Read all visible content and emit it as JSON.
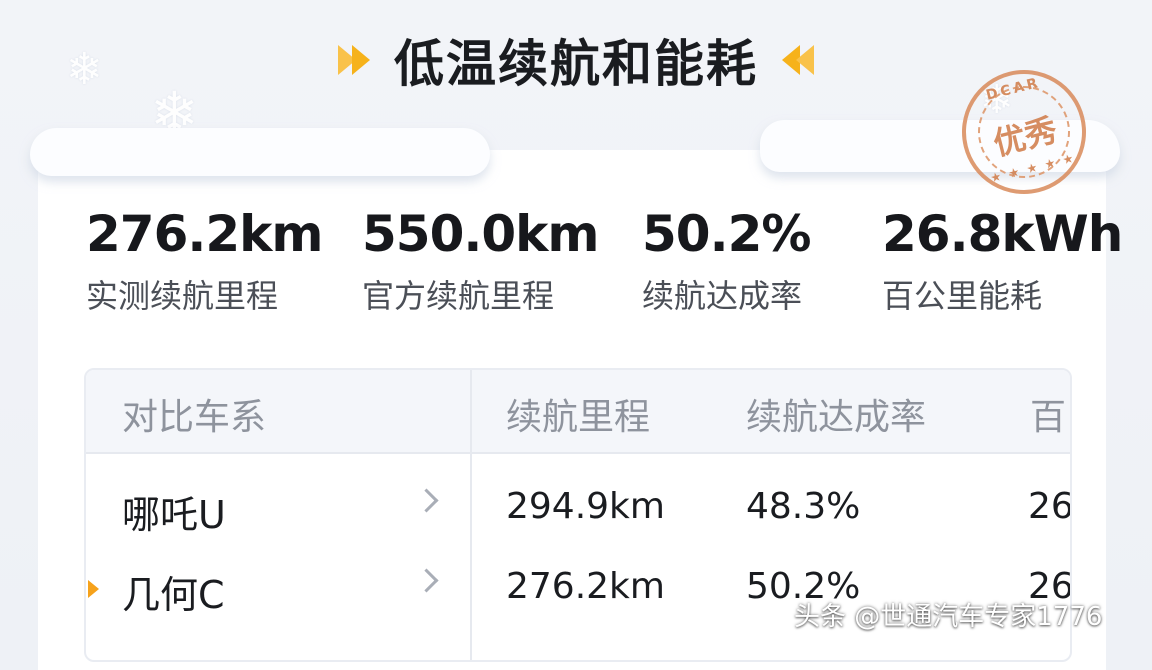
{
  "header": {
    "title": "低温续航和能耗"
  },
  "badge": {
    "ring_text": "DCAR",
    "label": "优秀",
    "stars": "★ ★ ★ ★ ★"
  },
  "metrics": [
    {
      "value": "276.2km",
      "label": "实测续航里程"
    },
    {
      "value": "550.0km",
      "label": "官方续航里程"
    },
    {
      "value": "50.2%",
      "label": "续航达成率"
    },
    {
      "value": "26.8kWh",
      "label": "百公里能耗"
    }
  ],
  "table": {
    "headers": [
      "对比车系",
      "续航里程",
      "续航达成率",
      "百"
    ],
    "rows": [
      {
        "name": "哪吒U",
        "range": "294.9km",
        "rate": "48.3%",
        "energy": "26"
      },
      {
        "name": "几何C",
        "range": "276.2km",
        "rate": "50.2%",
        "energy": "26"
      }
    ]
  },
  "watermark": "头条 @世通汽车专家1776",
  "colors": {
    "accent_orange": "#f6b21b",
    "stamp": "#d07a46",
    "background": "#eef1f6"
  },
  "icons": [
    "snowflake-icon",
    "chevron-right-icon",
    "double-chevron-icon"
  ]
}
